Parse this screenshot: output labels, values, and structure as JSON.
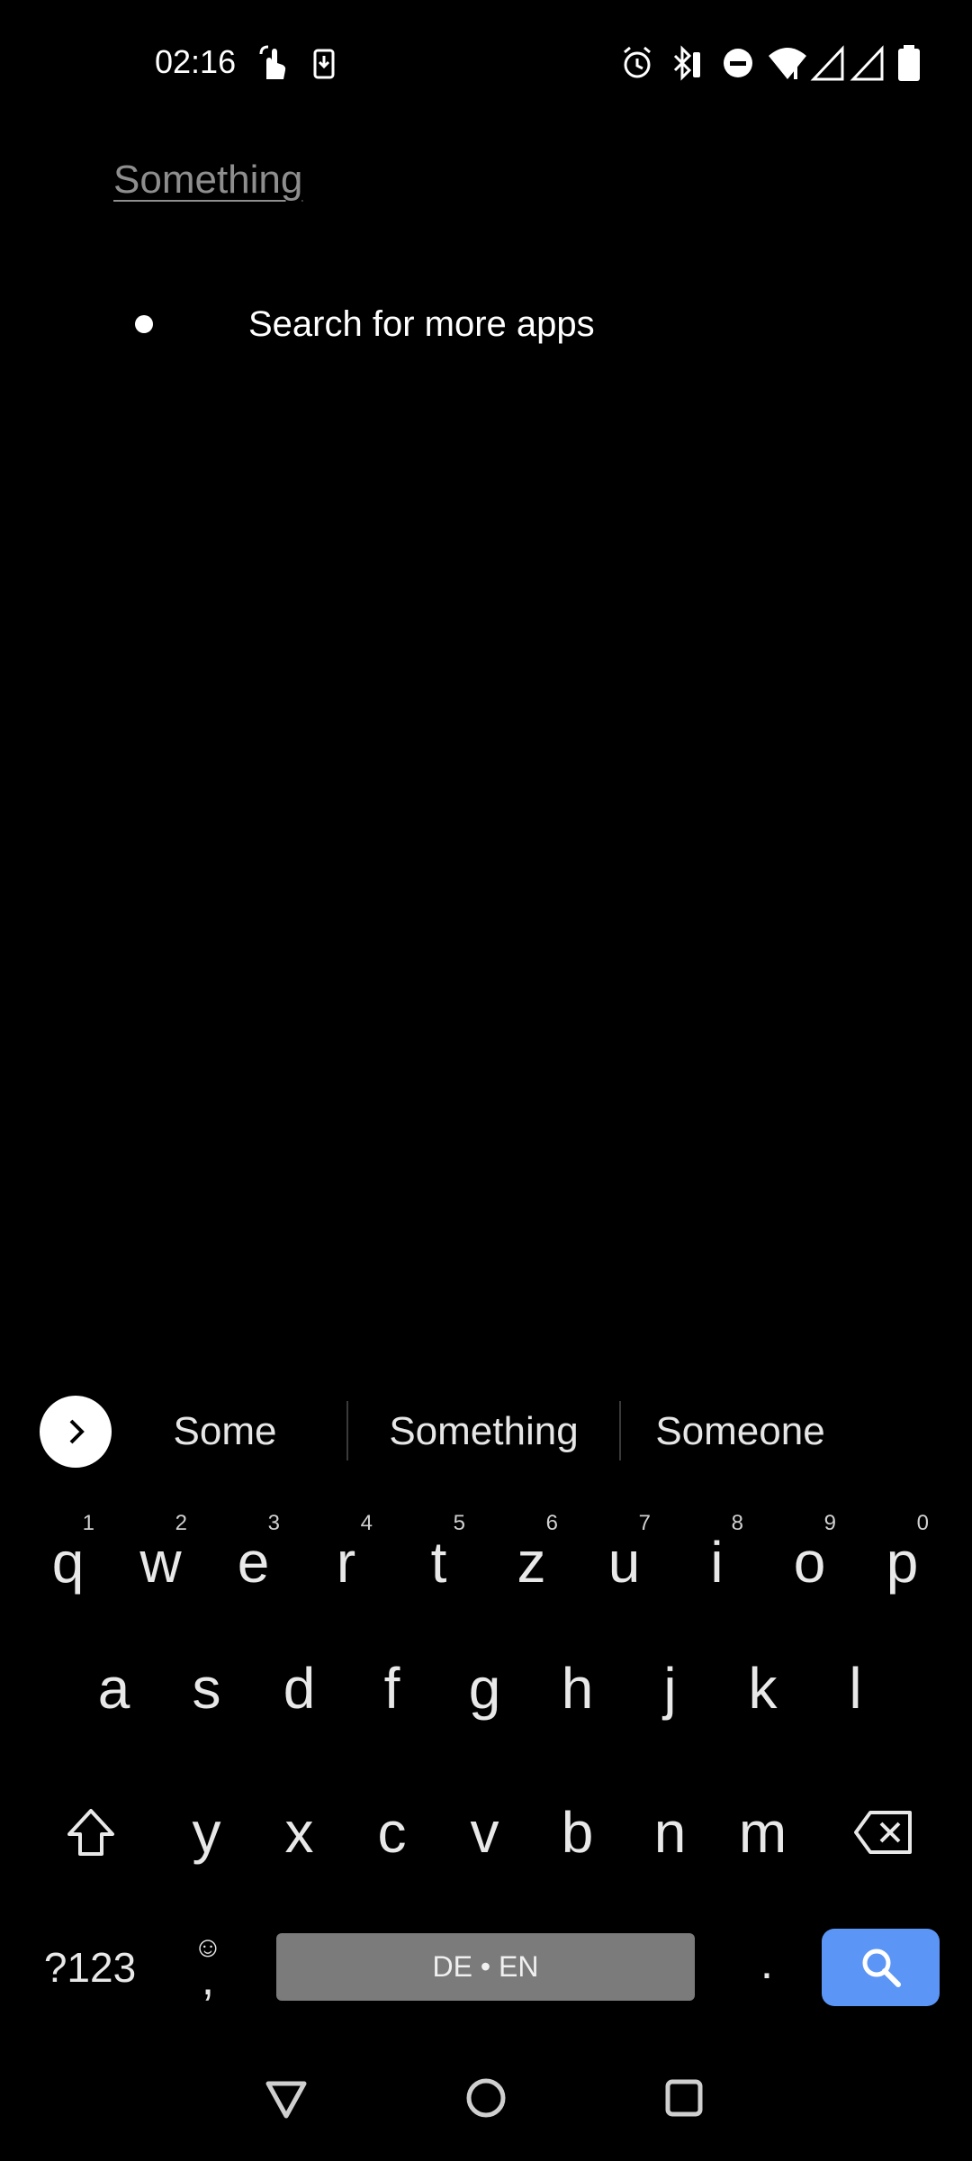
{
  "status_bar": {
    "time": "02:16",
    "icons": [
      "touch-icon",
      "screenshot-icon",
      "alarm-icon",
      "bluetooth-icon",
      "dnd-icon",
      "wifi-icon",
      "signal-icon",
      "signal-icon",
      "battery-icon"
    ]
  },
  "search": {
    "query": "Something"
  },
  "results": [
    {
      "label": "Search for more apps"
    }
  ],
  "suggestions": [
    "Some",
    "Something",
    "Someone"
  ],
  "keyboard": {
    "row1": [
      {
        "key": "q",
        "hint": "1"
      },
      {
        "key": "w",
        "hint": "2"
      },
      {
        "key": "e",
        "hint": "3"
      },
      {
        "key": "r",
        "hint": "4"
      },
      {
        "key": "t",
        "hint": "5"
      },
      {
        "key": "z",
        "hint": "6"
      },
      {
        "key": "u",
        "hint": "7"
      },
      {
        "key": "i",
        "hint": "8"
      },
      {
        "key": "o",
        "hint": "9"
      },
      {
        "key": "p",
        "hint": "0"
      }
    ],
    "row2": [
      "a",
      "s",
      "d",
      "f",
      "g",
      "h",
      "j",
      "k",
      "l"
    ],
    "row3": [
      "y",
      "x",
      "c",
      "v",
      "b",
      "n",
      "m"
    ],
    "symbols_label": "?123",
    "comma_label": ",",
    "emoji_hint": "☺",
    "space_label": "DE • EN",
    "period_label": ".",
    "accent_color": "#5b95f5"
  },
  "nav": {
    "icons": [
      "back-icon",
      "home-icon",
      "recents-icon"
    ]
  }
}
